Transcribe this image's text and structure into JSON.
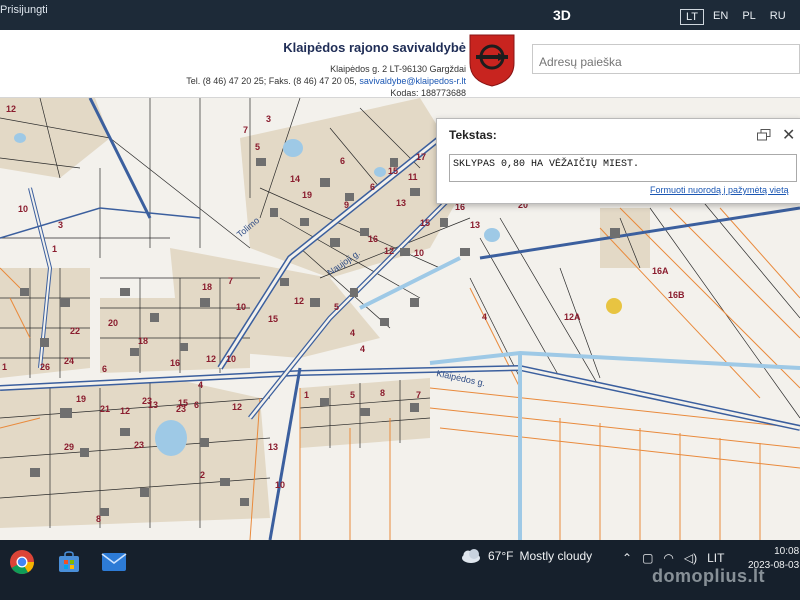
{
  "topbar": {
    "login_label": "Prisijungti",
    "mode_label": "3D",
    "languages": [
      "LT",
      "EN",
      "PL",
      "RU"
    ],
    "active_language": "LT"
  },
  "header": {
    "org_name": "Klaipėdos rajono savivaldybė",
    "address": "Klaipėdos g. 2 LT-96130 Gargždai",
    "contacts_prefix": "Tel. (8 46) 47 20 25; Faks. (8 46) 47 20 05, ",
    "email": "savivaldybe@klaipedos-r.lt",
    "code": "Kodas: 188773688",
    "brand_color": "#c8241f",
    "search_placeholder": "Adresų paieška"
  },
  "text_panel": {
    "title": "Tekstas:",
    "value": "SKLYPAS 0,80 HA VĖŽAIČIŲ MIEST.",
    "link_label": "Formuoti nuorodą į pažymėtą vietą"
  },
  "map": {
    "street_labels": [
      "Tolimo",
      "Naujoji g.",
      "Klaipėdos g."
    ],
    "parcel_numbers": [
      "12",
      "7",
      "3",
      "5",
      "6",
      "15",
      "17",
      "10",
      "3",
      "1",
      "14",
      "19",
      "9",
      "6",
      "13",
      "11",
      "15",
      "16",
      "13",
      "20",
      "16",
      "12",
      "10",
      "4",
      "18",
      "7",
      "10",
      "15",
      "12",
      "5",
      "4",
      "4",
      "12A",
      "16A",
      "16B",
      "22",
      "20",
      "18",
      "24",
      "26",
      "1",
      "6",
      "16",
      "10",
      "8",
      "12",
      "13",
      "6",
      "12",
      "10",
      "23",
      "23",
      "4",
      "13",
      "19",
      "21",
      "12",
      "15",
      "29",
      "2",
      "23",
      "1",
      "5",
      "8",
      "7",
      "14"
    ],
    "colors": {
      "water": "#9ec9e6",
      "roads": "#3b5f9e",
      "parcel_lines_orange": "#e98a3c",
      "buildings": "#6f6f6f",
      "plot_label": "#8a1c2e",
      "marker": "#e8c441"
    }
  },
  "taskbar": {
    "apps": [
      "chrome-icon",
      "store-icon",
      "mail-icon"
    ],
    "weather_temp": "67°F",
    "weather_desc": "Mostly cloudy",
    "language": "LIT",
    "time": "10:08",
    "date": "2023-08-03"
  },
  "watermark": "domoplius.lt"
}
